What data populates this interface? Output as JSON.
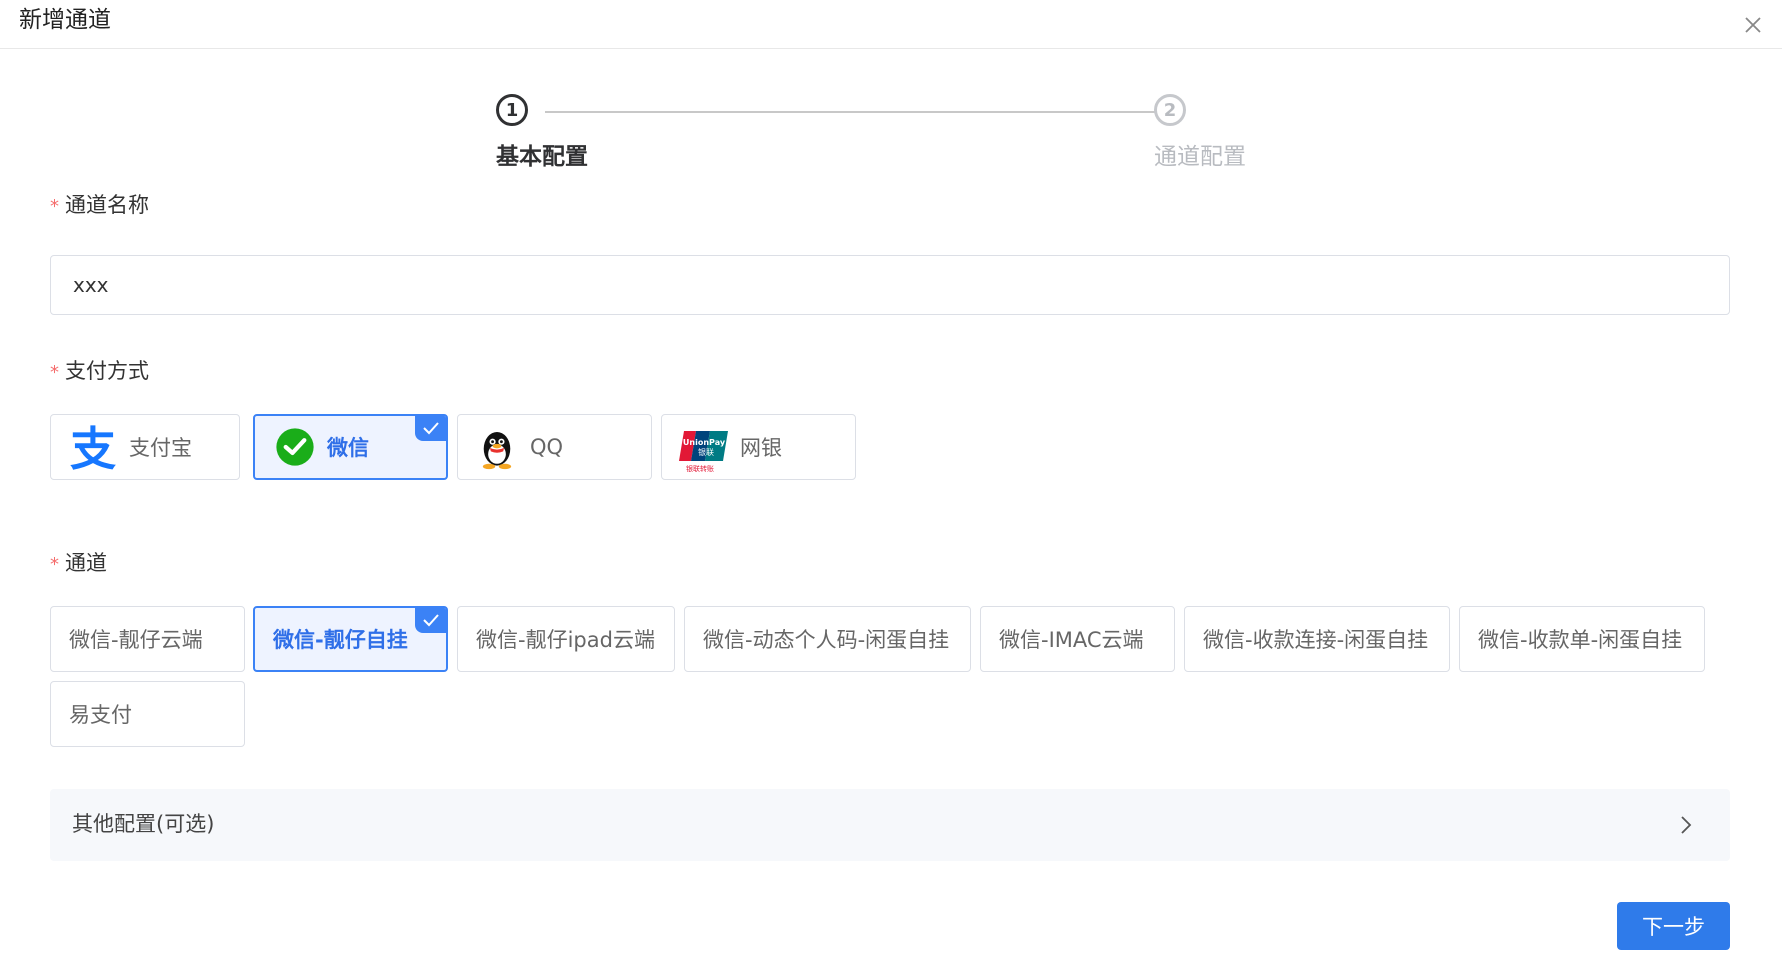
{
  "dialog": {
    "title": "新增通道"
  },
  "steps": [
    {
      "number": "1",
      "label": "基本配置",
      "state": "active"
    },
    {
      "number": "2",
      "label": "通道配置",
      "state": "inactive"
    }
  ],
  "form": {
    "name": {
      "label": "通道名称",
      "value": "xxx",
      "required": true
    },
    "payment": {
      "label": "支付方式",
      "required": true,
      "options": [
        {
          "label": "支付宝",
          "icon": "alipay-icon",
          "selected": false
        },
        {
          "label": "微信",
          "icon": "wechat-icon",
          "selected": true
        },
        {
          "label": "QQ",
          "icon": "qq-icon",
          "selected": false
        },
        {
          "label": "网银",
          "icon": "unionpay-icon",
          "selected": false
        }
      ]
    },
    "channel": {
      "label": "通道",
      "required": true,
      "options": [
        {
          "label": "微信-靓仔云端",
          "selected": false
        },
        {
          "label": "微信-靓仔自挂",
          "selected": true
        },
        {
          "label": "微信-靓仔ipad云端",
          "selected": false
        },
        {
          "label": "微信-动态个人码-闲蛋自挂",
          "selected": false
        },
        {
          "label": "微信-IMAC云端",
          "selected": false
        },
        {
          "label": "微信-收款连接-闲蛋自挂",
          "selected": false
        },
        {
          "label": "微信-收款单-闲蛋自挂",
          "selected": false
        },
        {
          "label": "易支付",
          "selected": false
        }
      ]
    },
    "other": {
      "title": "其他配置(可选)"
    }
  },
  "buttons": {
    "next": "下一步"
  },
  "colors": {
    "primary": "#2f7bea",
    "selected_border": "#3b82f6",
    "required": "#f56c6c"
  }
}
